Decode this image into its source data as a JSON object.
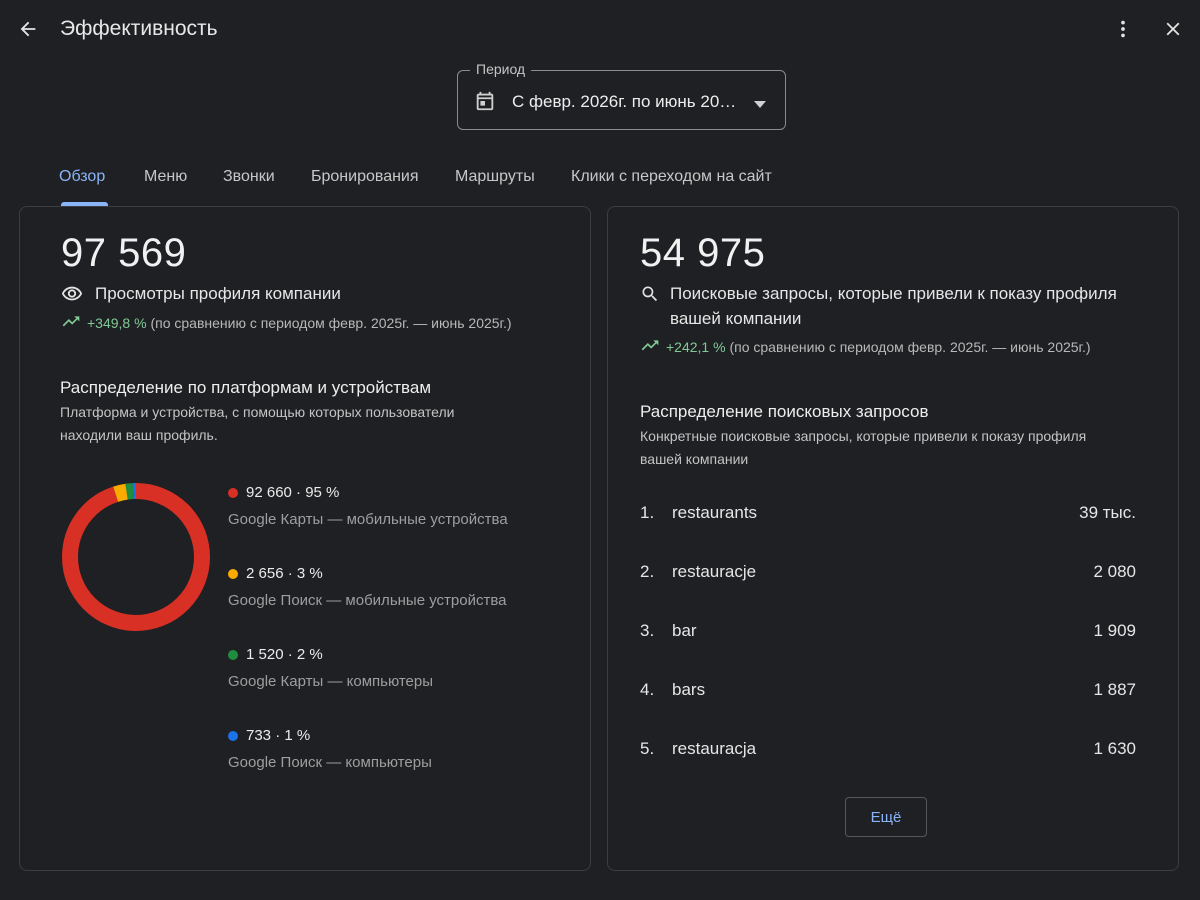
{
  "header": {
    "title": "Эффективность",
    "back_icon": "arrow-back-icon",
    "more_icon": "more-vert-icon",
    "close_icon": "close-icon"
  },
  "period": {
    "label": "Период",
    "value": "С февр. 2026г. по июнь 20…",
    "icon": "calendar-icon"
  },
  "tabs": [
    {
      "label": "Обзор",
      "active": true
    },
    {
      "label": "Меню",
      "active": false
    },
    {
      "label": "Звонки",
      "active": false
    },
    {
      "label": "Бронирования",
      "active": false
    },
    {
      "label": "Маршруты",
      "active": false
    },
    {
      "label": "Клики с переходом на сайт",
      "active": false
    }
  ],
  "views": {
    "total": "97 569",
    "label": "Просмотры профиля компании",
    "icon": "eye-icon",
    "change": "+349,8 %",
    "comparison": "(по сравнению с периодом февр. 2025г. — июнь 2025г.)",
    "distribution_title": "Распределение по платформам и устройствам",
    "distribution_subtitle_line1": "Платформа и устройства, с помощью которых пользователи",
    "distribution_subtitle_line2": "находили ваш профиль.",
    "segments": [
      {
        "value_text": "92 660 · 95 %",
        "label": "Google Карты — мобильные устройства",
        "value": 92660,
        "color": "#d93025"
      },
      {
        "value_text": "2 656 · 3 %",
        "label": "Google Поиск — мобильные устройства",
        "value": 2656,
        "color": "#f9ab00"
      },
      {
        "value_text": "1 520 · 2 %",
        "label": "Google Карты — компьютеры",
        "value": 1520,
        "color": "#1e8e3e"
      },
      {
        "value_text": "733 · 1 %",
        "label": "Google Поиск — компьютеры",
        "value": 733,
        "color": "#1a73e8"
      }
    ]
  },
  "searches": {
    "total": "54 975",
    "label_line1": "Поисковые запросы, которые привели к показу профиля",
    "label_line2": "вашей компании",
    "icon": "search-icon",
    "change": "+242,1 %",
    "comparison": "(по сравнению с периодом февр. 2025г. — июнь 2025г.)",
    "distribution_title": "Распределение поисковых запросов",
    "distribution_subtitle_line1": "Конкретные поисковые запросы, которые привели к показу профиля",
    "distribution_subtitle_line2": "вашей компании",
    "queries": [
      {
        "rank": "1.",
        "text": "restaurants",
        "value": "39 тыс."
      },
      {
        "rank": "2.",
        "text": "restauracje",
        "value": "2 080"
      },
      {
        "rank": "3.",
        "text": "bar",
        "value": "1 909"
      },
      {
        "rank": "4.",
        "text": "bars",
        "value": "1 887"
      },
      {
        "rank": "5.",
        "text": "restauracja",
        "value": "1 630"
      }
    ],
    "more_label": "Ещё"
  },
  "colors": {
    "accent": "#8ab4f8",
    "trend_up": "#81c995"
  }
}
